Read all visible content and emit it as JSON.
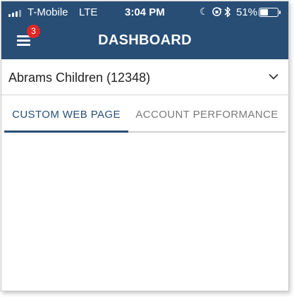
{
  "status_bar": {
    "carrier": "T-Mobile",
    "network": "LTE",
    "time": "3:04 PM",
    "battery_percent": "51%",
    "battery_level": 0.51,
    "icons": [
      "moon-icon",
      "orientation-lock-icon",
      "bluetooth-icon"
    ]
  },
  "app_bar": {
    "title": "DASHBOARD",
    "notification_count": "3",
    "menu_icon": "hamburger-menu-icon"
  },
  "account_selector": {
    "value": "Abrams Children (12348)",
    "icon": "chevron-down-icon"
  },
  "tabs": [
    {
      "label": "CUSTOM WEB PAGE",
      "active": true
    },
    {
      "label": "ACCOUNT PERFORMANCE",
      "active": false
    }
  ],
  "colors": {
    "primary": "#284e76",
    "badge": "#e02727",
    "inactive_tab": "#7a7a7a"
  }
}
